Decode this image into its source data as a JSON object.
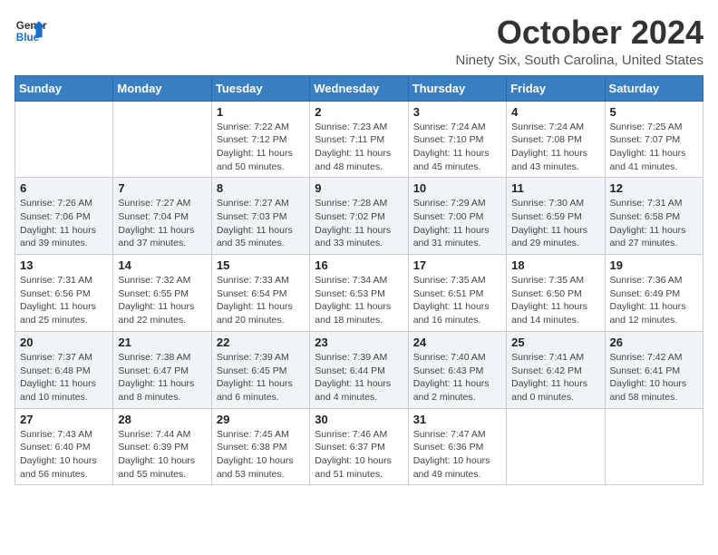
{
  "logo": {
    "line1": "General",
    "line2": "Blue"
  },
  "title": "October 2024",
  "location": "Ninety Six, South Carolina, United States",
  "weekdays": [
    "Sunday",
    "Monday",
    "Tuesday",
    "Wednesday",
    "Thursday",
    "Friday",
    "Saturday"
  ],
  "weeks": [
    [
      {
        "day": "",
        "info": ""
      },
      {
        "day": "",
        "info": ""
      },
      {
        "day": "1",
        "info": "Sunrise: 7:22 AM\nSunset: 7:12 PM\nDaylight: 11 hours and 50 minutes."
      },
      {
        "day": "2",
        "info": "Sunrise: 7:23 AM\nSunset: 7:11 PM\nDaylight: 11 hours and 48 minutes."
      },
      {
        "day": "3",
        "info": "Sunrise: 7:24 AM\nSunset: 7:10 PM\nDaylight: 11 hours and 45 minutes."
      },
      {
        "day": "4",
        "info": "Sunrise: 7:24 AM\nSunset: 7:08 PM\nDaylight: 11 hours and 43 minutes."
      },
      {
        "day": "5",
        "info": "Sunrise: 7:25 AM\nSunset: 7:07 PM\nDaylight: 11 hours and 41 minutes."
      }
    ],
    [
      {
        "day": "6",
        "info": "Sunrise: 7:26 AM\nSunset: 7:06 PM\nDaylight: 11 hours and 39 minutes."
      },
      {
        "day": "7",
        "info": "Sunrise: 7:27 AM\nSunset: 7:04 PM\nDaylight: 11 hours and 37 minutes."
      },
      {
        "day": "8",
        "info": "Sunrise: 7:27 AM\nSunset: 7:03 PM\nDaylight: 11 hours and 35 minutes."
      },
      {
        "day": "9",
        "info": "Sunrise: 7:28 AM\nSunset: 7:02 PM\nDaylight: 11 hours and 33 minutes."
      },
      {
        "day": "10",
        "info": "Sunrise: 7:29 AM\nSunset: 7:00 PM\nDaylight: 11 hours and 31 minutes."
      },
      {
        "day": "11",
        "info": "Sunrise: 7:30 AM\nSunset: 6:59 PM\nDaylight: 11 hours and 29 minutes."
      },
      {
        "day": "12",
        "info": "Sunrise: 7:31 AM\nSunset: 6:58 PM\nDaylight: 11 hours and 27 minutes."
      }
    ],
    [
      {
        "day": "13",
        "info": "Sunrise: 7:31 AM\nSunset: 6:56 PM\nDaylight: 11 hours and 25 minutes."
      },
      {
        "day": "14",
        "info": "Sunrise: 7:32 AM\nSunset: 6:55 PM\nDaylight: 11 hours and 22 minutes."
      },
      {
        "day": "15",
        "info": "Sunrise: 7:33 AM\nSunset: 6:54 PM\nDaylight: 11 hours and 20 minutes."
      },
      {
        "day": "16",
        "info": "Sunrise: 7:34 AM\nSunset: 6:53 PM\nDaylight: 11 hours and 18 minutes."
      },
      {
        "day": "17",
        "info": "Sunrise: 7:35 AM\nSunset: 6:51 PM\nDaylight: 11 hours and 16 minutes."
      },
      {
        "day": "18",
        "info": "Sunrise: 7:35 AM\nSunset: 6:50 PM\nDaylight: 11 hours and 14 minutes."
      },
      {
        "day": "19",
        "info": "Sunrise: 7:36 AM\nSunset: 6:49 PM\nDaylight: 11 hours and 12 minutes."
      }
    ],
    [
      {
        "day": "20",
        "info": "Sunrise: 7:37 AM\nSunset: 6:48 PM\nDaylight: 11 hours and 10 minutes."
      },
      {
        "day": "21",
        "info": "Sunrise: 7:38 AM\nSunset: 6:47 PM\nDaylight: 11 hours and 8 minutes."
      },
      {
        "day": "22",
        "info": "Sunrise: 7:39 AM\nSunset: 6:45 PM\nDaylight: 11 hours and 6 minutes."
      },
      {
        "day": "23",
        "info": "Sunrise: 7:39 AM\nSunset: 6:44 PM\nDaylight: 11 hours and 4 minutes."
      },
      {
        "day": "24",
        "info": "Sunrise: 7:40 AM\nSunset: 6:43 PM\nDaylight: 11 hours and 2 minutes."
      },
      {
        "day": "25",
        "info": "Sunrise: 7:41 AM\nSunset: 6:42 PM\nDaylight: 11 hours and 0 minutes."
      },
      {
        "day": "26",
        "info": "Sunrise: 7:42 AM\nSunset: 6:41 PM\nDaylight: 10 hours and 58 minutes."
      }
    ],
    [
      {
        "day": "27",
        "info": "Sunrise: 7:43 AM\nSunset: 6:40 PM\nDaylight: 10 hours and 56 minutes."
      },
      {
        "day": "28",
        "info": "Sunrise: 7:44 AM\nSunset: 6:39 PM\nDaylight: 10 hours and 55 minutes."
      },
      {
        "day": "29",
        "info": "Sunrise: 7:45 AM\nSunset: 6:38 PM\nDaylight: 10 hours and 53 minutes."
      },
      {
        "day": "30",
        "info": "Sunrise: 7:46 AM\nSunset: 6:37 PM\nDaylight: 10 hours and 51 minutes."
      },
      {
        "day": "31",
        "info": "Sunrise: 7:47 AM\nSunset: 6:36 PM\nDaylight: 10 hours and 49 minutes."
      },
      {
        "day": "",
        "info": ""
      },
      {
        "day": "",
        "info": ""
      }
    ]
  ]
}
